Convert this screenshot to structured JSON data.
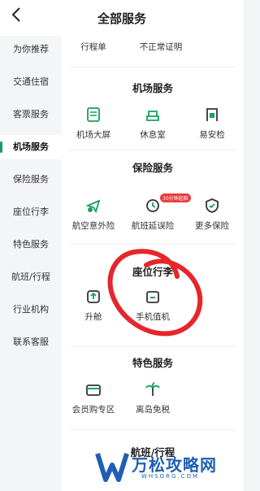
{
  "header": {
    "title": "全部服务",
    "back_icon": "chevron-left-icon"
  },
  "sidebar": {
    "items": [
      {
        "label": "为你推荐"
      },
      {
        "label": "交通住宿"
      },
      {
        "label": "客票服务"
      },
      {
        "label": "机场服务",
        "active": true
      },
      {
        "label": "保险服务"
      },
      {
        "label": "座位行李"
      },
      {
        "label": "特色服务"
      },
      {
        "label": "航班/行程"
      },
      {
        "label": "行业机构"
      },
      {
        "label": "联系客服"
      }
    ]
  },
  "content": {
    "top_partial": {
      "items": [
        {
          "label": "行程单"
        },
        {
          "label": "不正常证明"
        }
      ]
    },
    "airport": {
      "title": "机场服务",
      "items": [
        {
          "label": "机场大屏",
          "icon": "screen-icon"
        },
        {
          "label": "休息室",
          "icon": "lounge-icon"
        },
        {
          "label": "易安检",
          "icon": "security-check-icon"
        }
      ]
    },
    "insurance": {
      "title": "保险服务",
      "items": [
        {
          "label": "航空意外险",
          "icon": "plane-shield-icon"
        },
        {
          "label": "航班延误险",
          "icon": "delay-icon",
          "badge": "30分钟起赔"
        },
        {
          "label": "更多保险",
          "icon": "shield-check-icon"
        }
      ]
    },
    "seat": {
      "title": "座位行李",
      "items": [
        {
          "label": "升舱",
          "icon": "upgrade-icon"
        },
        {
          "label": "手机值机",
          "icon": "checkin-icon"
        }
      ]
    },
    "special": {
      "title": "特色服务",
      "items": [
        {
          "label": "会员购专区",
          "icon": "shop-icon"
        },
        {
          "label": "离岛免税",
          "icon": "palm-tree-icon"
        }
      ]
    },
    "partial_next": {
      "title": "航班/行程"
    }
  },
  "watermark": {
    "text": "万松攻略网",
    "sub": "WHSORG.COM"
  },
  "colors": {
    "accent": "#17a05d",
    "badge": "#e83c3c",
    "annotation": "#e5262b",
    "watermark": "#1f5fb3"
  }
}
